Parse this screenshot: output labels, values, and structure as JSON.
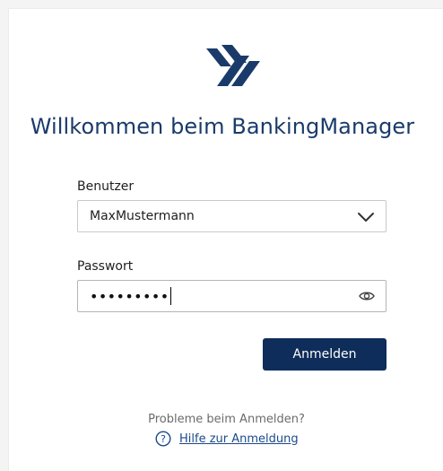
{
  "header": {
    "title": "Willkommen beim BankingManager"
  },
  "form": {
    "user_label": "Benutzer",
    "user_value": "MaxMustermann",
    "password_label": "Passwort",
    "password_masked": "•••••••••",
    "submit_label": "Anmelden"
  },
  "help": {
    "problem_text": "Probleme beim Anmelden?",
    "link_text": "Hilfe zur Anmeldung"
  },
  "icons": {
    "logo": "logo-icon",
    "dropdown": "chevron-down-icon",
    "password_toggle": "eye-icon",
    "help": "question-circle-icon"
  },
  "colors": {
    "brand": "#1a3b6a",
    "button": "#0f2d5a",
    "link": "#1a4a8a"
  }
}
